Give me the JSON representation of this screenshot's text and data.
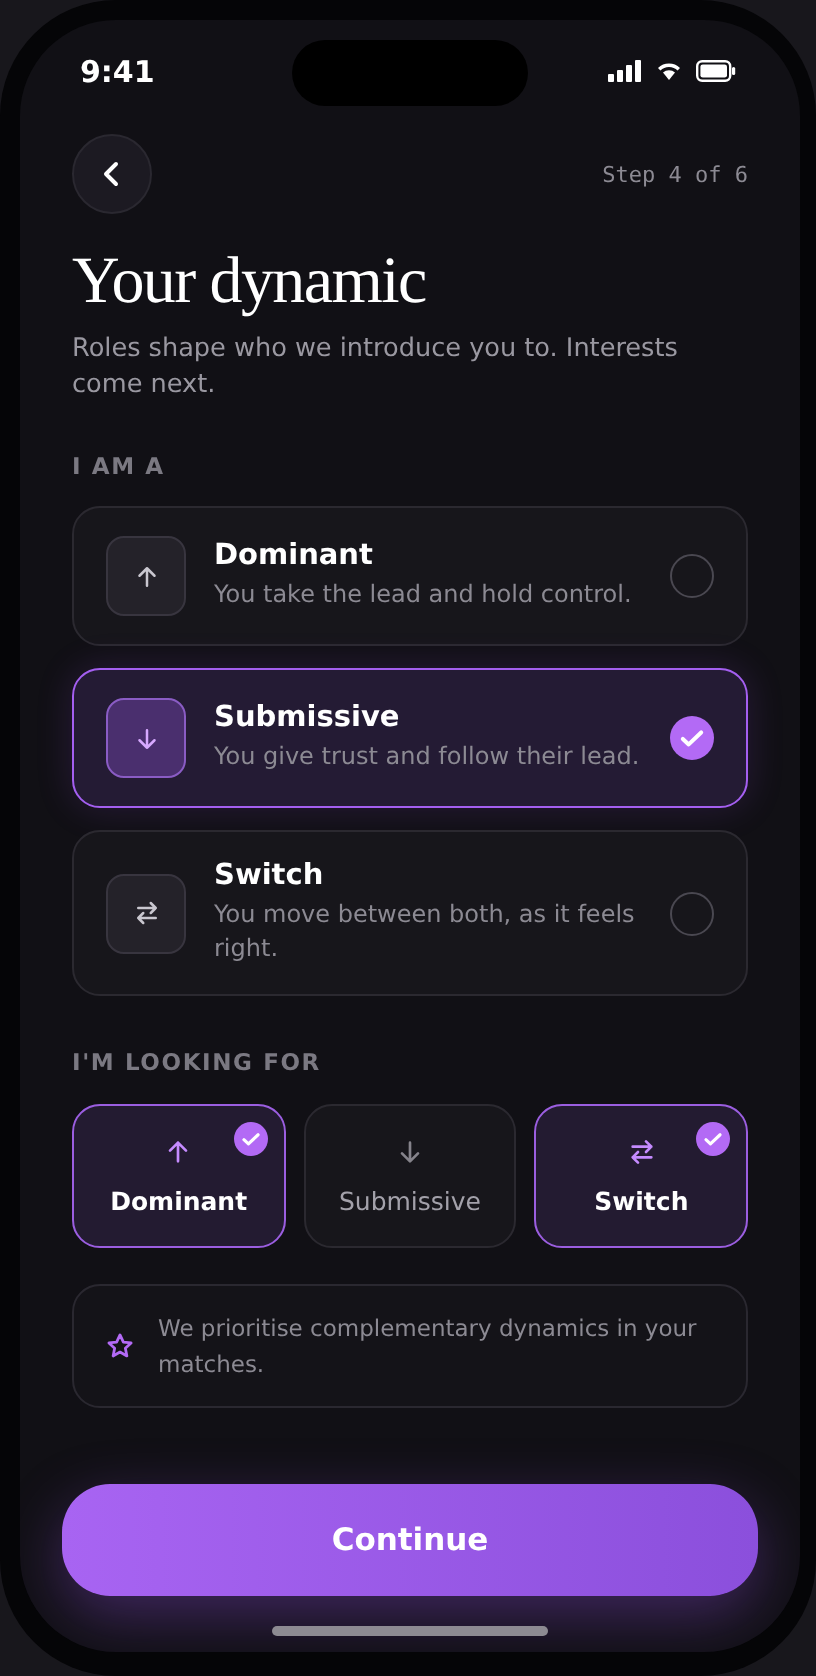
{
  "status_bar": {
    "time": "9:41"
  },
  "header": {
    "step": "Step 4 of 6"
  },
  "title": "Your dynamic",
  "subtitle": "Roles shape who we introduce you to. Interests come next.",
  "i_am": {
    "label": "I AM A",
    "options": [
      {
        "kind": "up",
        "title": "Dominant",
        "description": "You take the lead and hold control.",
        "selected": false
      },
      {
        "kind": "down",
        "title": "Submissive",
        "description": "You give trust and follow their lead.",
        "selected": true
      },
      {
        "kind": "swap",
        "title": "Switch",
        "description": "You move between both, as it feels right.",
        "selected": false
      }
    ]
  },
  "looking_for": {
    "label": "I'M LOOKING FOR",
    "options": [
      {
        "kind": "up",
        "label": "Dominant",
        "selected": true
      },
      {
        "kind": "down",
        "label": "Submissive",
        "selected": false
      },
      {
        "kind": "swap",
        "label": "Switch",
        "selected": true
      }
    ]
  },
  "note": {
    "text": "We prioritise complementary dynamics in your matches."
  },
  "continue_button": "Continue"
}
